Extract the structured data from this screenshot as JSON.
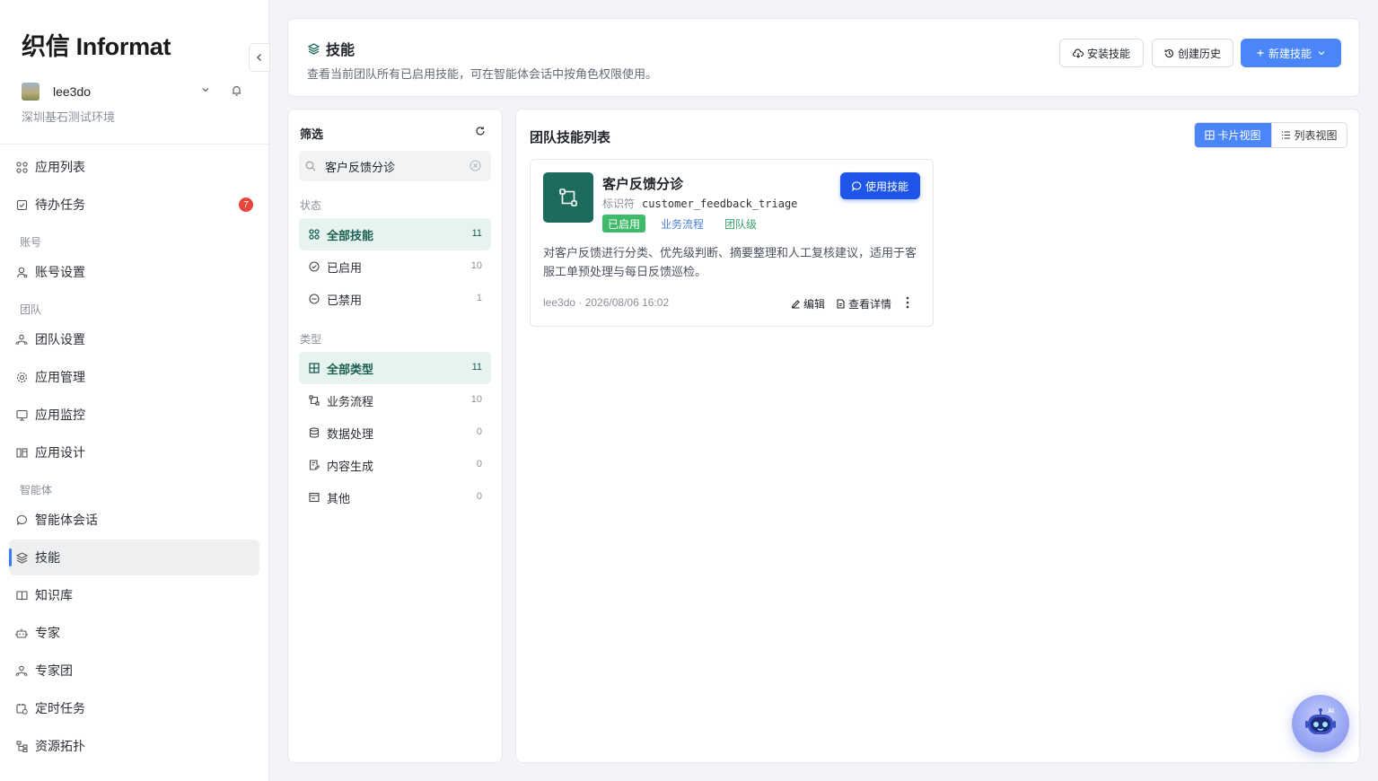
{
  "brand": {
    "name": "织信 Informat"
  },
  "user": {
    "name": "lee3do",
    "org": "深圳基石测试环境"
  },
  "nav": {
    "app_list": "应用列表",
    "todo": "待办任务",
    "todo_badge": "7",
    "group_account": "账号",
    "account_settings": "账号设置",
    "group_team": "团队",
    "team_settings": "团队设置",
    "app_manage": "应用管理",
    "app_monitor": "应用监控",
    "app_design": "应用设计",
    "group_agent": "智能体",
    "agent_chat": "智能体会话",
    "skills": "技能",
    "knowledge": "知识库",
    "experts": "专家",
    "expert_team": "专家团",
    "scheduled": "定时任务",
    "topology": "资源拓扑"
  },
  "header": {
    "title": "技能",
    "description": "查看当前团队所有已启用技能，可在智能体会话中按角色权限使用。",
    "install_btn": "安装技能",
    "history_btn": "创建历史",
    "new_btn": "新建技能"
  },
  "filter": {
    "title": "筛选",
    "search_value": "客户反馈分诊",
    "status_label": "状态",
    "status_items": [
      {
        "label": "全部技能",
        "count": "11"
      },
      {
        "label": "已启用",
        "count": "10"
      },
      {
        "label": "已禁用",
        "count": "1"
      }
    ],
    "type_label": "类型",
    "type_items": [
      {
        "label": "全部类型",
        "count": "11"
      },
      {
        "label": "业务流程",
        "count": "10"
      },
      {
        "label": "数据处理",
        "count": "0"
      },
      {
        "label": "内容生成",
        "count": "0"
      },
      {
        "label": "其他",
        "count": "0"
      }
    ]
  },
  "list": {
    "title": "团队技能列表",
    "card_view": "卡片视图",
    "list_view": "列表视图"
  },
  "skill": {
    "name": "客户反馈分诊",
    "id_label": "标识符",
    "id": "customer_feedback_triage",
    "tag_status": "已启用",
    "tag_type": "业务流程",
    "tag_scope": "团队级",
    "use_btn": "使用技能",
    "description": "对客户反馈进行分类、优先级判断、摘要整理和人工复核建议，适用于客服工单预处理与每日反馈巡检。",
    "meta": "lee3do · 2026/08/06 16:02",
    "edit": "编辑",
    "detail": "查看详情"
  },
  "colors": {
    "primary": "#4a86f7",
    "brand_green": "#1d6b5d",
    "badge_red": "#e8453c",
    "enabled_green": "#3fba6a"
  }
}
